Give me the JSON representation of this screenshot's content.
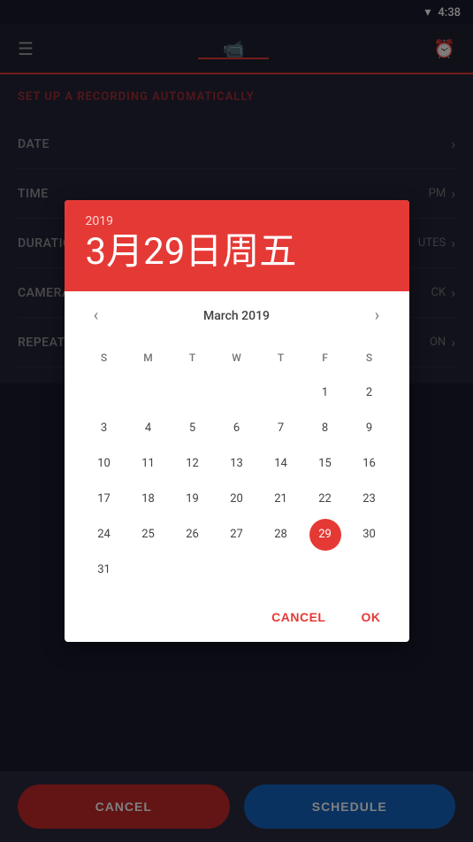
{
  "statusBar": {
    "time": "4:38",
    "wifiIcon": "▾"
  },
  "topNav": {
    "menuIcon": "☰",
    "videoIcon": "▶",
    "alarmIcon": "⏰"
  },
  "page": {
    "title": "SET UP A RECORDING AUTOMATICALLY"
  },
  "settings": [
    {
      "label": "DATE",
      "value": "",
      "showChevron": true
    },
    {
      "label": "TIME",
      "value": "PM",
      "showChevron": true
    },
    {
      "label": "DURATION",
      "value": "UTES",
      "showChevron": true
    },
    {
      "label": "CAMERA",
      "value": "CK",
      "showChevron": true
    },
    {
      "label": "REPEAT",
      "value": "ON",
      "showChevron": true
    }
  ],
  "dialog": {
    "year": "2019",
    "dateMain": "3月29日周五",
    "monthLabel": "March 2019",
    "prevIcon": "‹",
    "nextIcon": "›",
    "dayHeaders": [
      "S",
      "M",
      "T",
      "W",
      "T",
      "F",
      "S"
    ],
    "weeks": [
      [
        "",
        "",
        "",
        "",
        "",
        "1",
        "2"
      ],
      [
        "3",
        "4",
        "5",
        "6",
        "7",
        "8",
        "9"
      ],
      [
        "10",
        "11",
        "12",
        "13",
        "14",
        "15",
        "16"
      ],
      [
        "17",
        "18",
        "19",
        "20",
        "21",
        "22",
        "23"
      ],
      [
        "24",
        "25",
        "26",
        "27",
        "28",
        "29",
        "30"
      ],
      [
        "31",
        "",
        "",
        "",
        "",
        "",
        ""
      ]
    ],
    "selectedDay": "29",
    "cancelLabel": "CANCEL",
    "okLabel": "OK"
  },
  "bottomBar": {
    "cancelLabel": "CANCEL",
    "scheduleLabel": "SCHEDULE"
  }
}
